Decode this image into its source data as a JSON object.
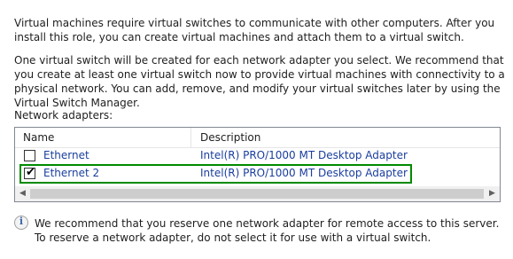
{
  "intro": "Virtual machines require virtual switches to communicate with other computers. After you install this role, you can create virtual machines and attach them to a virtual switch.",
  "details": "One virtual switch will be created for each network adapter you select. We recommend that you create at least one virtual switch now to provide virtual machines with connectivity to a physical network. You can add, remove, and modify your virtual switches later by using the Virtual Switch Manager.",
  "adapters_label": "Network adapters:",
  "table": {
    "columns": [
      "Name",
      "Description"
    ],
    "rows": [
      {
        "name": "Ethernet",
        "description": "Intel(R) PRO/1000 MT Desktop Adapter",
        "checked": false
      },
      {
        "name": "Ethernet 2",
        "description": "Intel(R) PRO/1000 MT Desktop Adapter",
        "checked": true
      }
    ]
  },
  "note": "We recommend that you reserve one network adapter for remote access to this server. To reserve a network adapter, do not select it for use with a virtual switch.",
  "icons": {
    "info": "info-icon",
    "check": "checkmark-icon",
    "scroll_left": "chevron-left-icon",
    "scroll_right": "chevron-right-icon"
  },
  "colors": {
    "highlight": "#008a00",
    "link_text": "#1a3e9e"
  }
}
